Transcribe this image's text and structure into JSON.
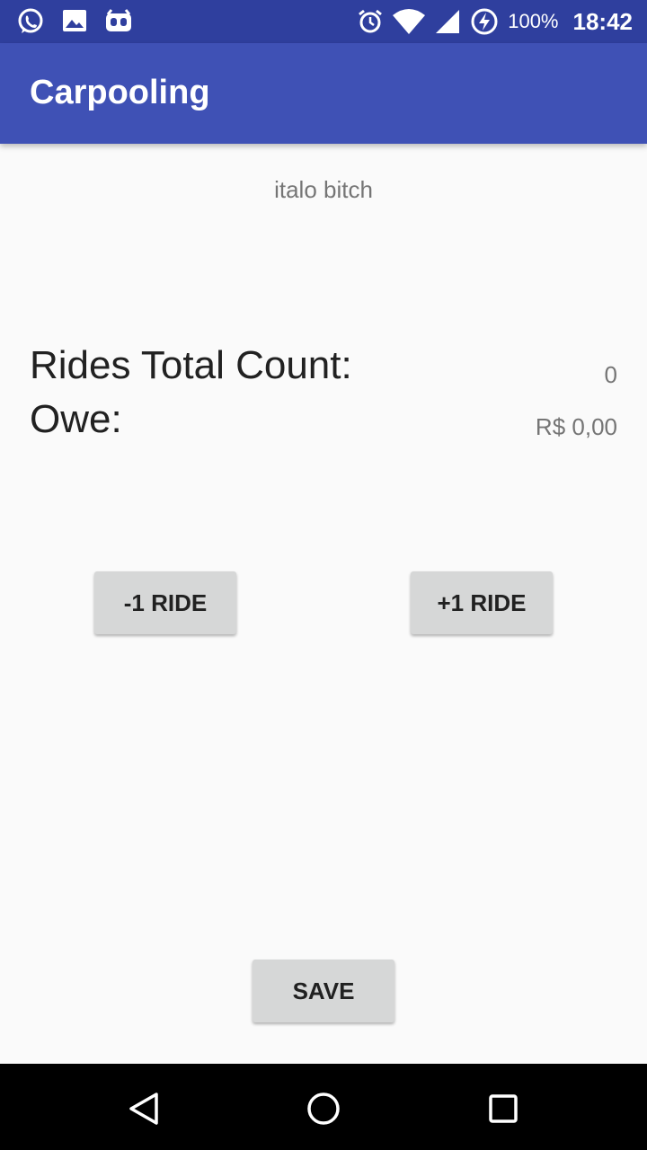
{
  "status_bar": {
    "battery": "100%",
    "time": "18:42",
    "left_icons": [
      "whatsapp-icon",
      "image-icon",
      "android-debug-icon"
    ],
    "right_icons": [
      "alarm-icon",
      "wifi-icon",
      "signal-icon",
      "battery-charging-icon"
    ]
  },
  "app_bar": {
    "title": "Carpooling"
  },
  "main": {
    "name": "italo bitch",
    "rides_label": "Rides Total Count:",
    "rides_value": "0",
    "owe_label": "Owe:",
    "owe_value": "R$ 0,00",
    "minus_button": "-1 RIDE",
    "plus_button": "+1 RIDE",
    "save_button": "SAVE"
  },
  "nav_bar": {
    "buttons": [
      "back-icon",
      "home-icon",
      "recents-icon"
    ]
  },
  "colors": {
    "primary": "#3f51b5",
    "primary_dark": "#2f3f9e",
    "button": "#d6d7d7"
  }
}
